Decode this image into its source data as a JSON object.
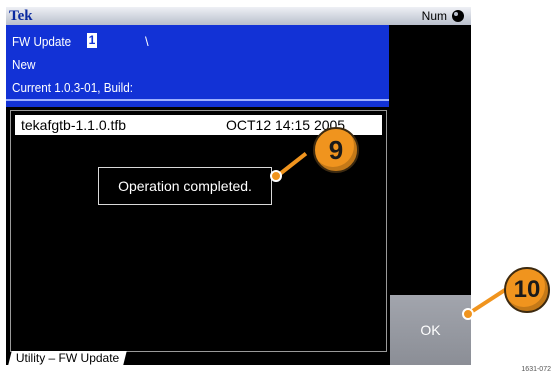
{
  "titlebar": {
    "brand": "Tek",
    "num_status": "Num",
    "disc_icon": "disc-icon"
  },
  "info": {
    "title": "FW Update",
    "cursor_char": "1",
    "path_char": "\\",
    "line_new": "New",
    "line_current": "Current 1.0.3-01, Build:"
  },
  "file_list": [
    {
      "name": "tekafgtb-1.1.0.tfb",
      "date": "OCT12 14:15 2005"
    }
  ],
  "dialog": {
    "message": "Operation completed."
  },
  "tab": {
    "label": "Utility – FW Update"
  },
  "softkeys": {
    "ok_label": "OK"
  },
  "callouts": [
    {
      "label": "9"
    },
    {
      "label": "10"
    }
  ],
  "colors": {
    "info_panel": "#1232d6",
    "callout": "#f0941e",
    "softkey": "#9a9da5"
  },
  "figure_ref": "1631-072"
}
